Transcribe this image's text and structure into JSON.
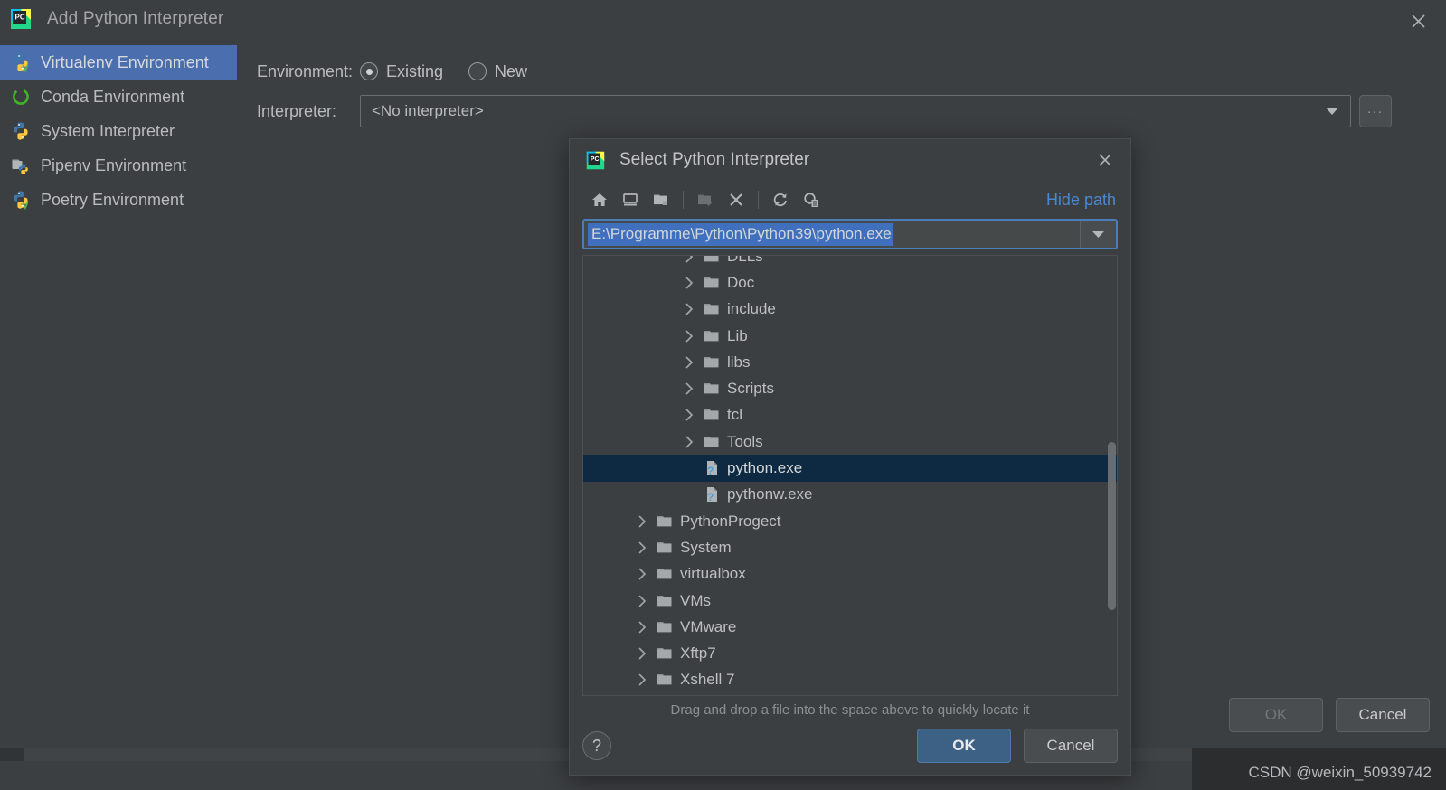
{
  "window": {
    "title": "Add Python Interpreter",
    "logo_icon": "pycharm-logo-icon",
    "close_icon": "close-icon",
    "ok_label": "OK",
    "cancel_label": "Cancel",
    "watermark": "CSDN @weixin_50939742"
  },
  "sidebar": {
    "items": [
      {
        "label": "Virtualenv Environment",
        "icon": "python-venv-icon",
        "selected": true
      },
      {
        "label": "Conda Environment",
        "icon": "conda-icon",
        "selected": false
      },
      {
        "label": "System Interpreter",
        "icon": "python-icon",
        "selected": false
      },
      {
        "label": "Pipenv Environment",
        "icon": "pipenv-icon",
        "selected": false
      },
      {
        "label": "Poetry Environment",
        "icon": "poetry-icon",
        "selected": false
      }
    ]
  },
  "form": {
    "environment_label": "Environment:",
    "radio_existing": "Existing",
    "radio_new": "New",
    "selected_radio": "Existing",
    "interpreter_label": "Interpreter:",
    "interpreter_value": "<No interpreter>",
    "browse_label": "...",
    "dropdown_icon": "chevron-down-icon"
  },
  "dialog": {
    "title": "Select Python Interpreter",
    "logo_icon": "pycharm-logo-icon",
    "close_icon": "close-icon",
    "toolbar": [
      {
        "name": "home-icon",
        "label": "Home directory",
        "enabled": true
      },
      {
        "name": "desktop-icon",
        "label": "Desktop directory",
        "enabled": true
      },
      {
        "name": "project-folder-icon",
        "label": "Project directory",
        "enabled": true
      },
      {
        "name": "new-folder-icon",
        "label": "New folder",
        "enabled": false
      },
      {
        "name": "delete-icon",
        "label": "Delete",
        "enabled": true
      },
      {
        "name": "refresh-icon",
        "label": "Refresh",
        "enabled": true
      },
      {
        "name": "show-hidden-icon",
        "label": "Show hidden files",
        "enabled": true
      }
    ],
    "hide_path_label": "Hide path",
    "path_value": "E:\\Programme\\Python\\Python39\\python.exe",
    "path_selected": true,
    "tree": [
      {
        "label": "DLLs",
        "type": "folder",
        "indent": 2,
        "expandable": true,
        "selected": false,
        "clipped_top": true
      },
      {
        "label": "Doc",
        "type": "folder",
        "indent": 2,
        "expandable": true,
        "selected": false
      },
      {
        "label": "include",
        "type": "folder",
        "indent": 2,
        "expandable": true,
        "selected": false
      },
      {
        "label": "Lib",
        "type": "folder",
        "indent": 2,
        "expandable": true,
        "selected": false
      },
      {
        "label": "libs",
        "type": "folder",
        "indent": 2,
        "expandable": true,
        "selected": false
      },
      {
        "label": "Scripts",
        "type": "folder",
        "indent": 2,
        "expandable": true,
        "selected": false
      },
      {
        "label": "tcl",
        "type": "folder",
        "indent": 2,
        "expandable": true,
        "selected": false
      },
      {
        "label": "Tools",
        "type": "folder",
        "indent": 2,
        "expandable": true,
        "selected": false
      },
      {
        "label": "python.exe",
        "type": "file",
        "indent": 2,
        "expandable": false,
        "selected": true
      },
      {
        "label": "pythonw.exe",
        "type": "file",
        "indent": 2,
        "expandable": false,
        "selected": false
      },
      {
        "label": "PythonProgect",
        "type": "folder",
        "indent": 1,
        "expandable": true,
        "selected": false
      },
      {
        "label": "System",
        "type": "folder",
        "indent": 1,
        "expandable": true,
        "selected": false
      },
      {
        "label": "virtualbox",
        "type": "folder",
        "indent": 1,
        "expandable": true,
        "selected": false
      },
      {
        "label": "VMs",
        "type": "folder",
        "indent": 1,
        "expandable": true,
        "selected": false
      },
      {
        "label": "VMware",
        "type": "folder",
        "indent": 1,
        "expandable": true,
        "selected": false
      },
      {
        "label": "Xftp7",
        "type": "folder",
        "indent": 1,
        "expandable": true,
        "selected": false
      },
      {
        "label": "Xshell 7",
        "type": "folder",
        "indent": 1,
        "expandable": true,
        "selected": false,
        "clipped_bottom": true
      }
    ],
    "hint": "Drag and drop a file into the space above to quickly locate it",
    "help_label": "?",
    "ok_label": "OK",
    "cancel_label": "Cancel"
  },
  "colors": {
    "background": "#3c3f41",
    "selection_blue": "#4b6eaf",
    "tree_selection": "#0d2a42",
    "link_blue": "#4a88d4",
    "primary_button": "#3d6185",
    "text_selection": "#3f6fbd"
  }
}
